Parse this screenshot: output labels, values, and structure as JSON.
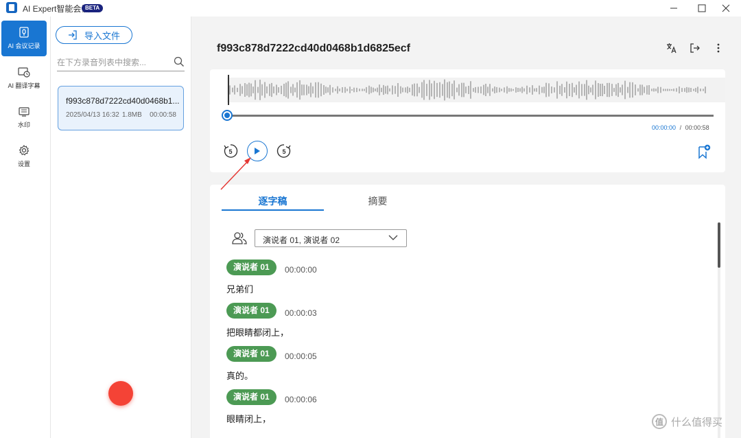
{
  "window": {
    "title": "AI Expert智能会议",
    "badge": "BETA",
    "controls": [
      "minimize",
      "maximize",
      "close"
    ]
  },
  "nav": {
    "items": [
      {
        "label": "AI 会议记录",
        "icon": "meeting-record-icon",
        "active": true
      },
      {
        "label": "AI 翻译字幕",
        "icon": "subtitle-icon",
        "active": false
      },
      {
        "label": "水印",
        "icon": "watermark-icon",
        "active": false
      },
      {
        "label": "设置",
        "icon": "gear-icon",
        "active": false
      }
    ]
  },
  "files": {
    "import_label": "导入文件",
    "search_placeholder": "在下方录音列表中搜索...",
    "items": [
      {
        "name": "f993c878d7222cd40d0468b1...",
        "date": "2025/04/13 16:32",
        "size": "1.8MB",
        "duration": "00:00:58"
      }
    ]
  },
  "main": {
    "title": "f993c878d7222cd40d0468b1d6825ecf",
    "icons": [
      "translate-icon",
      "export-icon",
      "more-icon"
    ]
  },
  "player": {
    "current_time": "00:00:00",
    "separator": "/",
    "total_time": "00:00:58",
    "progress": 0,
    "rewind_label": "5",
    "forward_label": "5"
  },
  "transcript": {
    "tabs": [
      "逐字稿",
      "摘要"
    ],
    "active_tab": 0,
    "speaker_filter": "演说者 01, 演说者 02",
    "segments": [
      {
        "speaker": "演说者 01",
        "time": "00:00:00",
        "text": "兄弟们"
      },
      {
        "speaker": "演说者 01",
        "time": "00:00:03",
        "text": "把眼睛都闭上，"
      },
      {
        "speaker": "演说者 01",
        "time": "00:00:05",
        "text": "真的。"
      },
      {
        "speaker": "演说者 01",
        "time": "00:00:06",
        "text": "眼睛闭上，"
      }
    ]
  },
  "watermark": {
    "logo": "值",
    "text": "什么值得买"
  },
  "colors": {
    "accent": "#1976d2",
    "speaker_badge": "#4c9a54",
    "record": "#f44336",
    "annotation_arrow": "#e53935"
  }
}
